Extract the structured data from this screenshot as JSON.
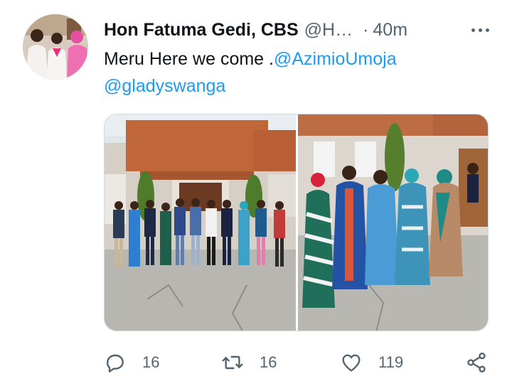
{
  "author": {
    "name": "Hon Fatuma Gedi, CBS",
    "handle": "@H…",
    "separator": "·",
    "time": "40m"
  },
  "tweet": {
    "text_part1": "Meru Here we come .",
    "mention1": "@AzimioUmoja",
    "mention2": "@gladyswanga"
  },
  "actions": {
    "reply_count": "16",
    "retweet_count": "16",
    "like_count": "119"
  },
  "icons": {
    "reply": "reply-icon",
    "retweet": "retweet-icon",
    "like": "heart-icon",
    "share": "share-icon",
    "more": "more-icon"
  },
  "colors": {
    "text": "#0f1419",
    "secondary": "#536471",
    "link": "#1d9bf0",
    "border": "#cfd9de"
  }
}
